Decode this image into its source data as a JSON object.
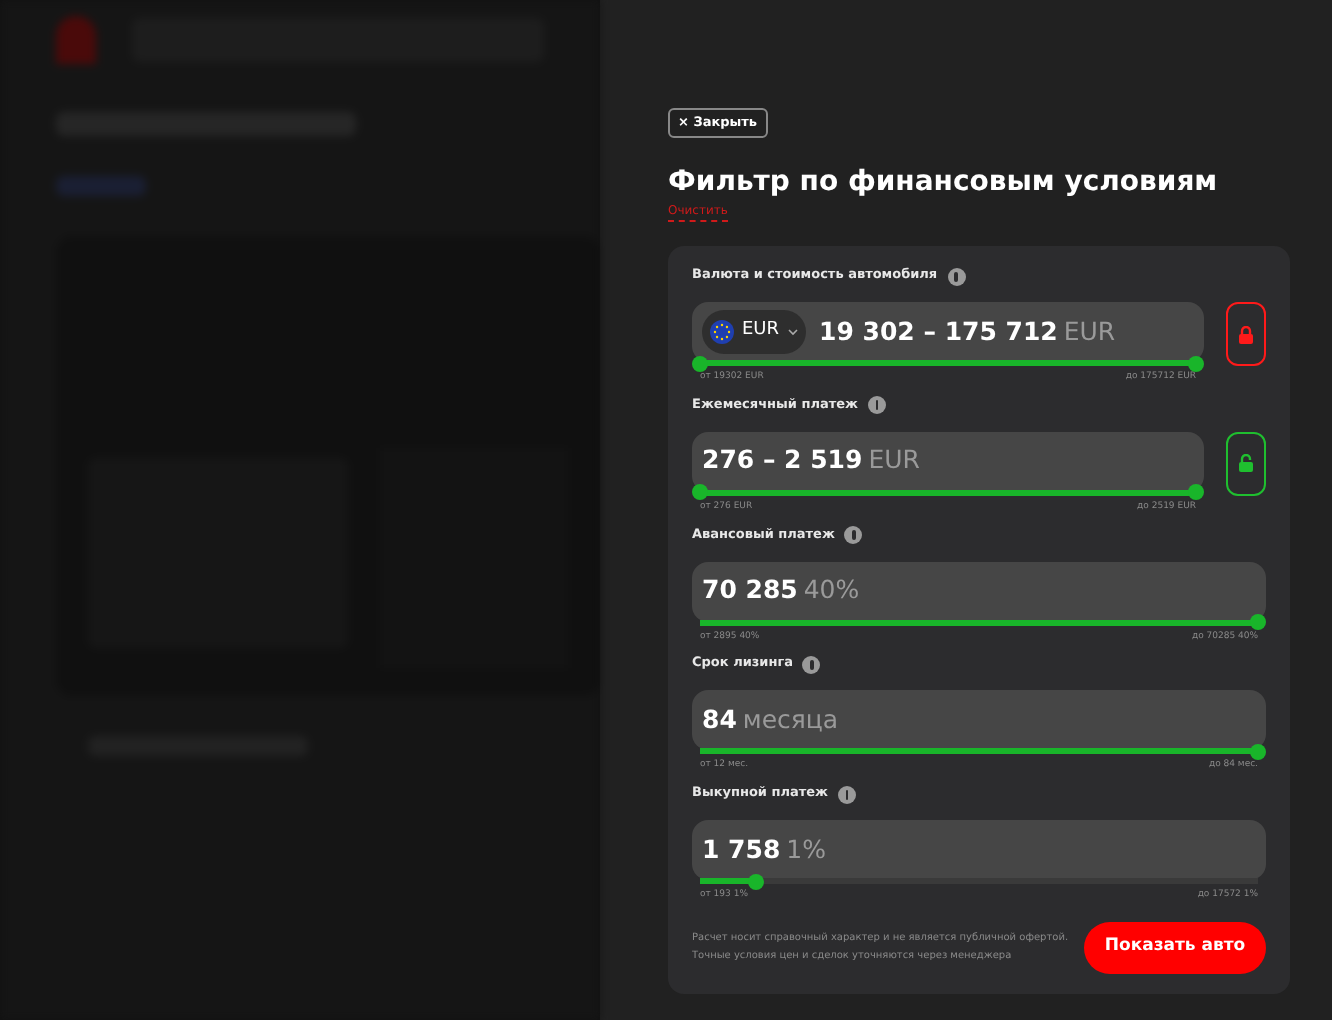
{
  "drawer": {
    "close_button": "× Закрыть",
    "title": "Фильтр по финансовым условиям",
    "clear_link": "Очистить",
    "fields": [
      {
        "label": "Валюта и стоимость автомобиля",
        "kind": "range",
        "currency": "EUR",
        "value": "19 302 – 175 712",
        "unit": "EUR",
        "level": 1,
        "min_label": "от 19302 EUR",
        "max_label": "до 175712 EUR",
        "locked": true
      },
      {
        "label": "Ежемесячный платеж",
        "kind": "range",
        "value": "276 – 2 519",
        "unit": "EUR",
        "level": 1,
        "min_label": "от 276 EUR",
        "max_label": "до 2519 EUR",
        "locked": false
      },
      {
        "label": "Авансовый платеж",
        "kind": "single",
        "value": "70 285",
        "unit": "40%",
        "level": 1,
        "min_label": "от 2895 40%",
        "max_label": "до 70285 40%"
      },
      {
        "label": "Срок лизинга",
        "kind": "single",
        "value": "84",
        "unit": "месяца",
        "level": 1,
        "min_label": "от 12 мес.",
        "max_label": "до 84 мес."
      },
      {
        "label": "Выкупной платеж",
        "kind": "single",
        "value": "1 758",
        "unit": "1%",
        "level": 0.1,
        "min_label": "от 193 1%",
        "max_label": "до 17572 1%"
      }
    ],
    "disclaimer": "Расчет носит справочный характер и не является публичной офертой. Точные условия цен и сделок уточняются через менеджера",
    "submit_button": "Показать авто"
  }
}
